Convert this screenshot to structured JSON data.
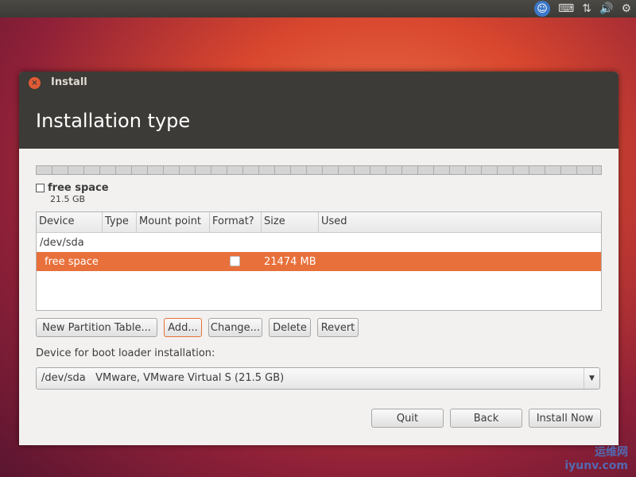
{
  "panel": {
    "icons": [
      "accessibility-icon",
      "keyboard-icon",
      "network-icon",
      "volume-icon",
      "settings-gear-icon"
    ]
  },
  "window": {
    "title": "Install",
    "page_title": "Installation type"
  },
  "partition_bar": {
    "legend_name": "free space",
    "legend_size": "21.5 GB",
    "color": "#ffffff"
  },
  "table": {
    "columns": [
      "Device",
      "Type",
      "Mount point",
      "Format?",
      "Size",
      "Used"
    ],
    "rows": [
      {
        "device": "/dev/sda",
        "size": ""
      },
      {
        "device": "free space",
        "format": false,
        "size": "21474 MB",
        "selected": true
      }
    ]
  },
  "buttons": {
    "new_table": "New Partition Table...",
    "add": "Add...",
    "change": "Change...",
    "delete": "Delete",
    "revert": "Revert",
    "quit": "Quit",
    "back": "Back",
    "install": "Install Now"
  },
  "bootloader": {
    "label": "Device for boot loader installation:",
    "value": "/dev/sda   VMware, VMware Virtual S (21.5 GB)"
  },
  "accent": "#e8703a",
  "watermark": {
    "cn": "运维网",
    "site": "iyunv.com"
  }
}
